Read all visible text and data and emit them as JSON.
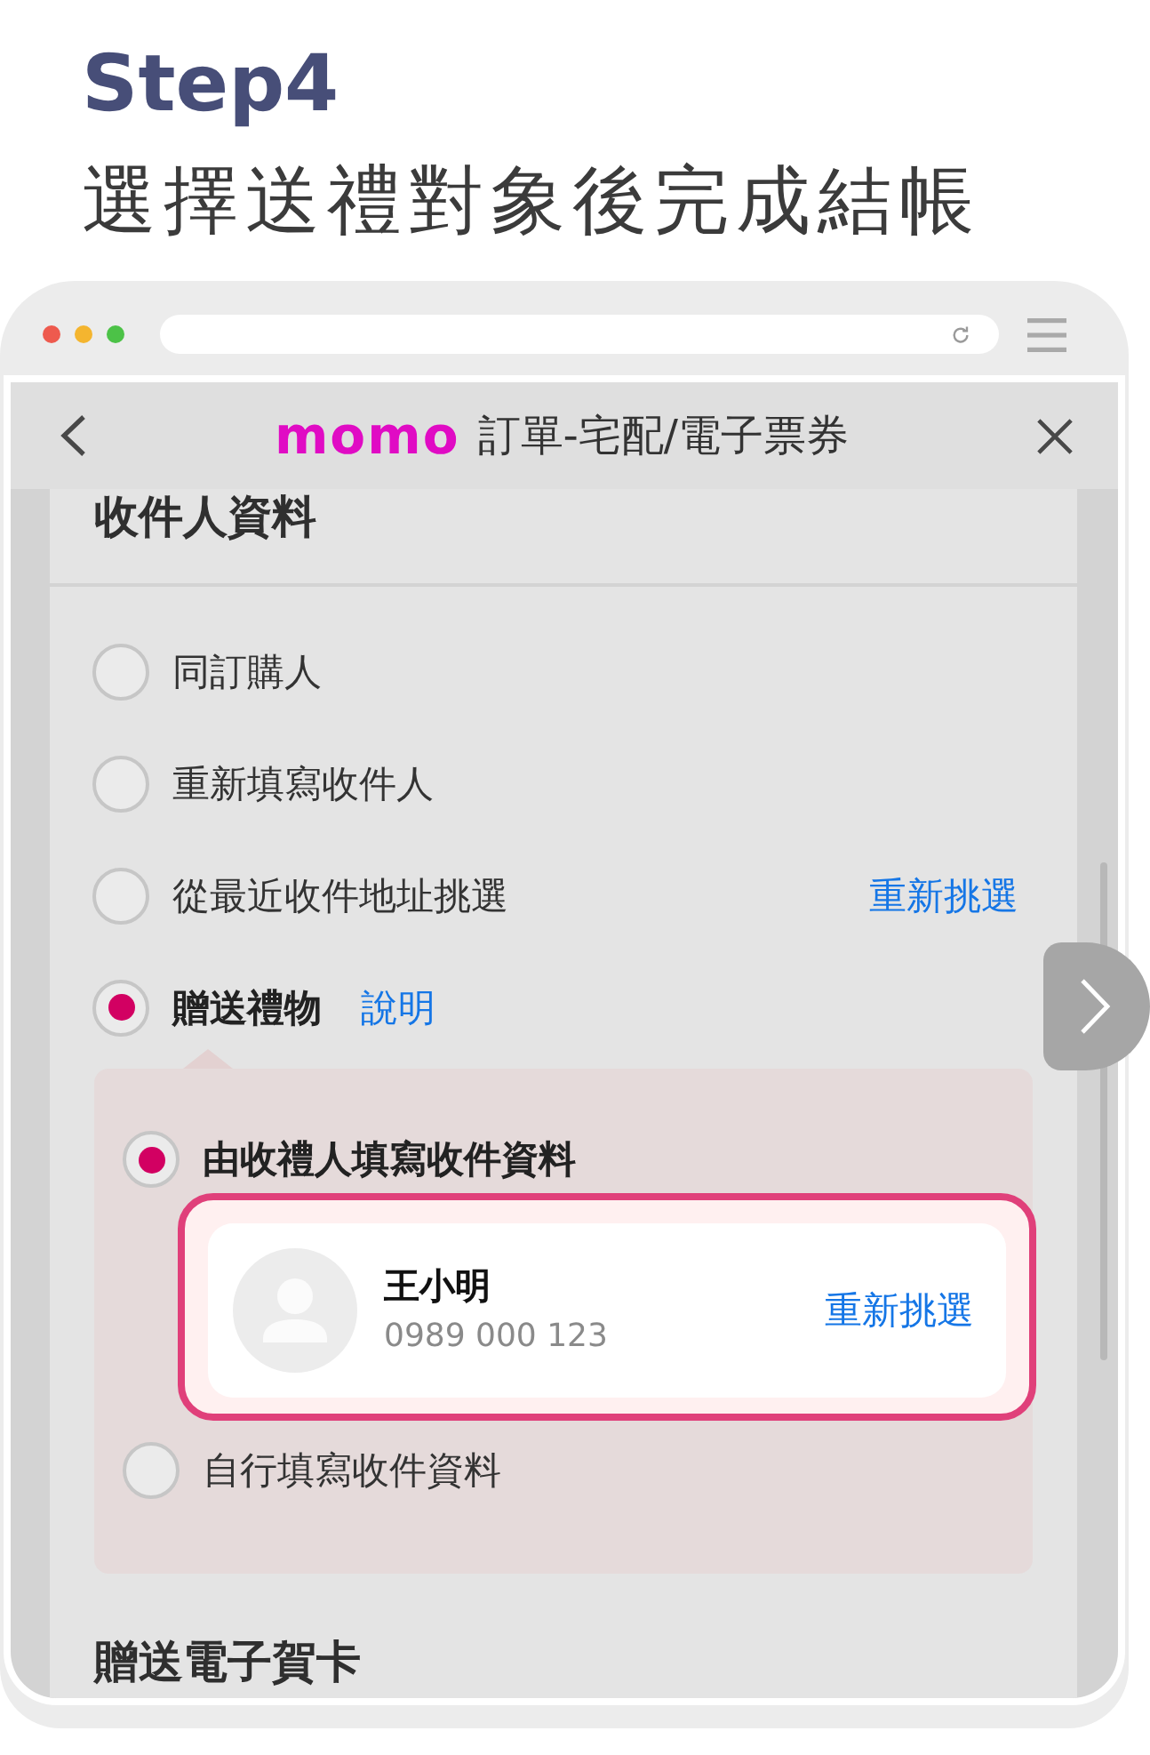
{
  "heading": {
    "step": "Step4",
    "title": "選擇送禮對象後完成結帳"
  },
  "app_bar": {
    "logo": "momo",
    "title": "訂單-宅配/電子票券"
  },
  "recipient": {
    "title": "收件人資料",
    "options": [
      {
        "label": "同訂購人",
        "selected": false
      },
      {
        "label": "重新填寫收件人",
        "selected": false
      },
      {
        "label": "從最近收件地址挑選",
        "selected": false,
        "link": {
          "kind": "action",
          "text": "重新挑選"
        }
      },
      {
        "label": "贈送禮物",
        "selected": true,
        "link": {
          "kind": "help",
          "text": "說明"
        }
      }
    ]
  },
  "gift": {
    "options": [
      {
        "label": "由收禮人填寫收件資料",
        "selected": true,
        "contact": {
          "name": "王小明",
          "phone": "0989 000 123",
          "link": "重新挑選"
        }
      },
      {
        "label": "自行填寫收件資料",
        "selected": false
      }
    ]
  },
  "greeting_card": {
    "title": "贈送電子賀卡"
  }
}
